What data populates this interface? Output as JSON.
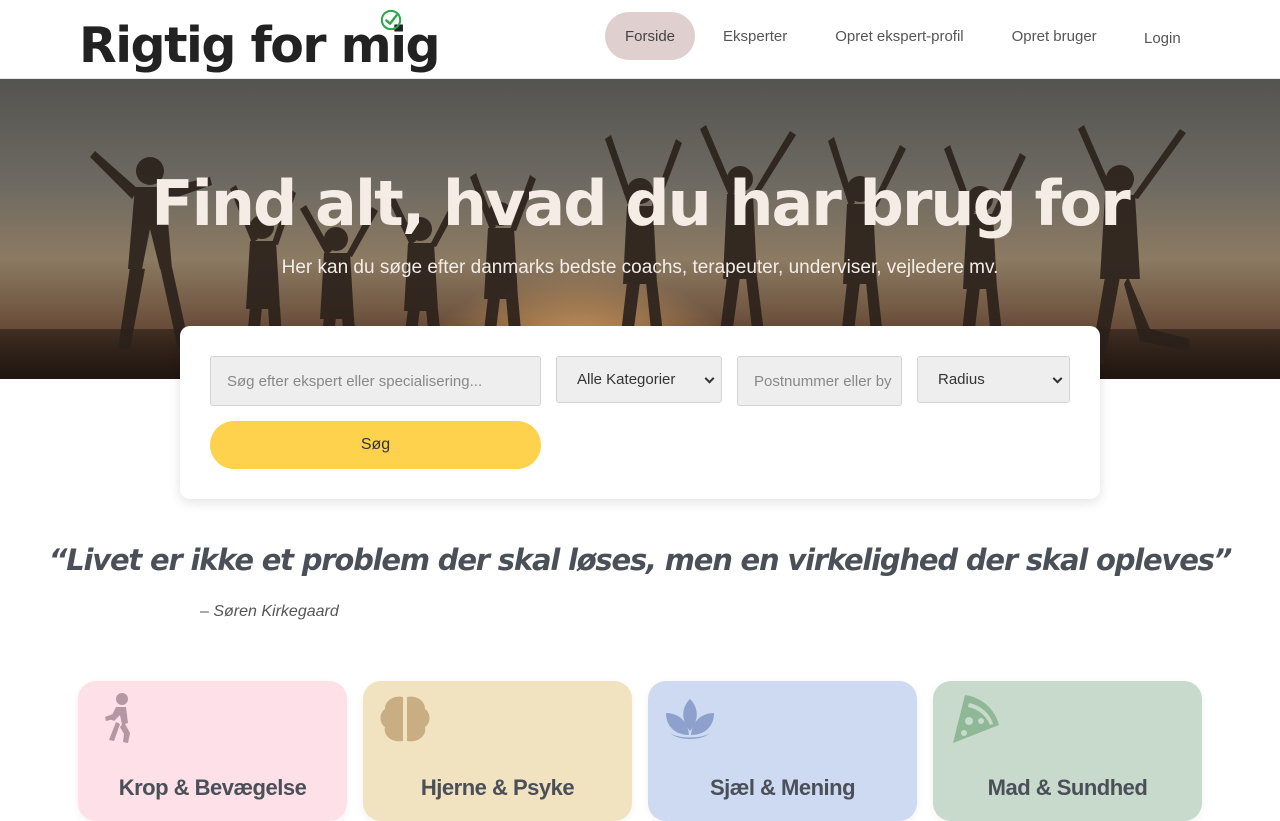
{
  "header": {
    "logo_text": "Rigtig for mig",
    "nav": [
      {
        "label": "Forside",
        "active": true
      },
      {
        "label": "Eksperter",
        "active": false
      },
      {
        "label": "Opret ekspert-profil",
        "active": false
      },
      {
        "label": "Opret bruger",
        "active": false
      }
    ],
    "login_label": "Login"
  },
  "hero": {
    "title": "Find alt, hvad du har brug for",
    "subtitle": "Her kan du søge efter danmarks bedste coachs, terapeuter, underviser, vejledere mv."
  },
  "search": {
    "query_placeholder": "Søg efter ekspert eller specialisering...",
    "category_selected": "Alle Kategorier",
    "location_placeholder": "Postnummer eller by",
    "radius_selected": "Radius",
    "submit_label": "Søg"
  },
  "quote": {
    "text": "“Livet er ikke et problem der skal løses, men en virkelighed der skal opleves”",
    "author": "– Søren Kirkegaard"
  },
  "categories": [
    {
      "label": "Krop & Bevægelse",
      "icon": "person-walking-icon",
      "color": "#fde0e8"
    },
    {
      "label": "Hjerne & Psyke",
      "icon": "brain-icon",
      "color": "#f1e2c0"
    },
    {
      "label": "Sjæl & Mening",
      "icon": "lotus-icon",
      "color": "#cddaf2"
    },
    {
      "label": "Mad & Sundhed",
      "icon": "pizza-slice-icon",
      "color": "#c8dacb"
    }
  ],
  "colors": {
    "accent_yellow": "#ffd24d",
    "nav_active": "#dfcfcf",
    "logo_check": "#2aa84a"
  }
}
